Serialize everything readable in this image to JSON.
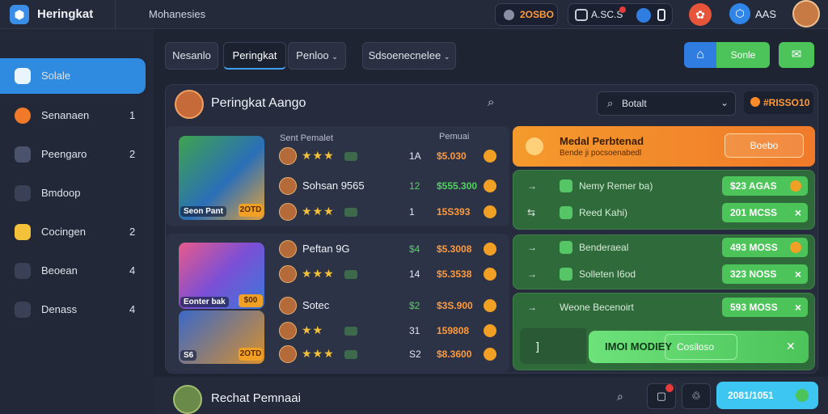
{
  "app": {
    "title": "Heringkat",
    "menu": "Mohanesies"
  },
  "topbar": {
    "coins": "2OSBO",
    "stats": "A.SC.S",
    "badge_value": "AAS"
  },
  "sidebar": {
    "items": [
      {
        "label": "Solale",
        "count": "",
        "icon": "home-icon",
        "active": true
      },
      {
        "label": "Senanaen",
        "count": "1",
        "icon": "target-icon"
      },
      {
        "label": "Peengaro",
        "count": "2",
        "icon": "user-icon"
      },
      {
        "label": "Bmdoop",
        "count": "",
        "icon": "chart-icon"
      },
      {
        "label": "Cocingen",
        "count": "2",
        "icon": "folder-icon"
      },
      {
        "label": "Beoean",
        "count": "4",
        "icon": "circle-icon"
      },
      {
        "label": "Denass",
        "count": "4",
        "icon": "tray-icon"
      }
    ]
  },
  "tabs": [
    {
      "label": "Nesanlo",
      "active": false
    },
    {
      "label": "Peringkat",
      "active": true
    },
    {
      "label": "Penloo",
      "active": false
    },
    {
      "label": "Sdsoenecnelee",
      "active": false
    }
  ],
  "actions": {
    "home": "⌂",
    "green": "Sonle",
    "mail": "✉"
  },
  "panel": {
    "title": "Peringkat Aango",
    "select_value": "Botalt",
    "gold": "#RISSO10",
    "col_name": "Sent Pemalet",
    "col_value": "Pemuai"
  },
  "groups": [
    {
      "thumb_tag": "Seon Pant",
      "thumb_price": "2OTD",
      "rows": [
        {
          "name": "",
          "stars": "★★★",
          "level": "1A",
          "value": "$5.030",
          "level_color": "w",
          "value_color": "o"
        },
        {
          "name": "Sohsan 9565",
          "stars": "",
          "level": "12",
          "value": "$555.300",
          "level_color": "g",
          "value_color": "g"
        },
        {
          "name": "",
          "stars": "★★★",
          "level": "1",
          "value": "15S393",
          "level_color": "w",
          "value_color": "o"
        }
      ]
    },
    {
      "thumb_tag": "Eonter bak",
      "thumb_price": "$00",
      "thumb_tag2": "S6",
      "thumb_price2": "2OTD",
      "rows": [
        {
          "name": "Peftan 9G",
          "stars": "",
          "level": "$4",
          "value": "$5.3008",
          "level_color": "g",
          "value_color": "o"
        },
        {
          "name": "",
          "stars": "★★★",
          "level": "14",
          "value": "$5.3538",
          "level_color": "w",
          "value_color": "o"
        },
        {
          "name": "Sotec",
          "stars": "",
          "level": "$2",
          "value": "$3S.900",
          "level_color": "g",
          "value_color": "o"
        },
        {
          "name": "",
          "stars": "★★",
          "level": "31",
          "value": "159808",
          "level_color": "w",
          "value_color": "o"
        },
        {
          "name": "",
          "stars": "★★★",
          "level": "S2",
          "value": "$8.3600",
          "level_color": "w",
          "value_color": "o"
        }
      ]
    }
  ],
  "promo": {
    "title": "Medal Perbtenad",
    "sub": "Bende ji pocsoenabedl",
    "button": "Boebo"
  },
  "green_rows": [
    {
      "arrow": "→",
      "label": "Nemy Remer ba)",
      "chip": "$23 AGAS",
      "chip_icon": "coin"
    },
    {
      "arrow": "⇆",
      "label": "Reed Kahi)",
      "chip": "201 MCSS",
      "chip_icon": "x"
    },
    {
      "arrow": "→",
      "label": "Benderaeal",
      "chip": "493 MOSS",
      "chip_icon": "coin"
    },
    {
      "arrow": "→",
      "label": "Solleten I6od",
      "chip": "323 NOSS",
      "chip_icon": "x"
    },
    {
      "arrow": "→",
      "label": "Weone Becenoirt",
      "chip": "593 MOSS",
      "chip_icon": "x"
    }
  ],
  "cta": {
    "left": "]",
    "label": "IMOI MODIEY",
    "inner": "Cosiloso",
    "icon": "✕"
  },
  "bottom": {
    "title": "Rechat Pemnaai",
    "score": "2081/1051"
  }
}
